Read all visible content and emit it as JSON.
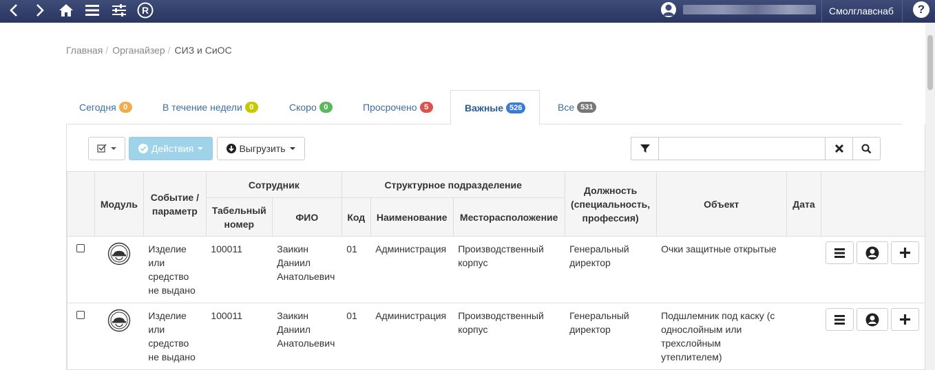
{
  "topbar": {
    "org_name": "Смолглавснаб",
    "help_label": "?",
    "icons": [
      "chevron-left-icon",
      "chevron-right-icon",
      "home-icon",
      "menu-icon",
      "sliders-icon",
      "registered-icon",
      "user-icon",
      "help-icon"
    ]
  },
  "breadcrumb": {
    "items": [
      "Главная",
      "Органайзер"
    ],
    "separator": "/",
    "current": "СИЗ и СиОС"
  },
  "tabs": [
    {
      "label": "Сегодня",
      "count": "0",
      "color": "#f0ad4e"
    },
    {
      "label": "В течение недели",
      "count": "0",
      "color": "#c8c800"
    },
    {
      "label": "Скоро",
      "count": "0",
      "color": "#5cb85c"
    },
    {
      "label": "Просрочено",
      "count": "5",
      "color": "#d9534f"
    },
    {
      "label": "Важные",
      "count": "526",
      "color": "#3a7bd5",
      "active": true
    },
    {
      "label": "Все",
      "count": "531",
      "color": "#777777"
    }
  ],
  "toolbar": {
    "actions_label": "Действия",
    "export_label": "Выгрузить",
    "search_value": ""
  },
  "table": {
    "headers": {
      "module": "Модуль",
      "event": "Событие / параметр",
      "employee": "Сотрудник",
      "tab_no": "Табельный номер",
      "fio": "ФИО",
      "division": "Структурное подразделение",
      "code": "Код",
      "name": "Наименование",
      "location": "Месторасположение",
      "position": "Должность (специальность, профессия)",
      "object": "Объект",
      "date": "Дата"
    },
    "rows": [
      {
        "event": "Изделие или средство не выдано",
        "tab_no": "100011",
        "fio": "Заикин Даниил Анатольевич",
        "code": "01",
        "name": "Администрация",
        "location": "Производственный корпус",
        "position": "Генеральный директор",
        "object": "Очки защитные открытые",
        "date": ""
      },
      {
        "event": "Изделие или средство не выдано",
        "tab_no": "100011",
        "fio": "Заикин Даниил Анатольевич",
        "code": "01",
        "name": "Администрация",
        "location": "Производственный корпус",
        "position": "Генеральный директор",
        "object": "Подшлемник под каску (с однослойным или трехслойным утеплителем)",
        "date": ""
      }
    ]
  }
}
